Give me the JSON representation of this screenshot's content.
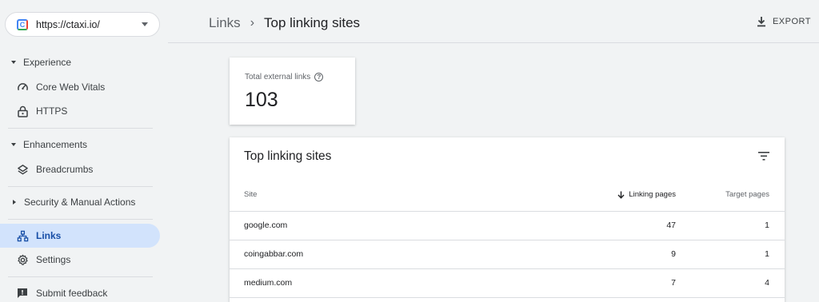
{
  "property": {
    "url": "https://ctaxi.io/"
  },
  "sidebar": {
    "sections": [
      {
        "label": "Experience"
      },
      {
        "label": "Enhancements"
      },
      {
        "label": "Security & Manual Actions"
      }
    ],
    "items": [
      {
        "label": "Core Web Vitals",
        "icon": "gauge-icon"
      },
      {
        "label": "HTTPS",
        "icon": "lock-icon"
      },
      {
        "label": "Breadcrumbs",
        "icon": "layers-icon"
      },
      {
        "label": "Links",
        "icon": "sitemap-icon",
        "active": true
      },
      {
        "label": "Settings",
        "icon": "gear-icon"
      },
      {
        "label": "Submit feedback",
        "icon": "feedback-icon"
      }
    ]
  },
  "header": {
    "breadcrumb_parent": "Links",
    "breadcrumb_current": "Top linking sites",
    "export_label": "EXPORT"
  },
  "summary": {
    "label": "Total external links",
    "value": "103"
  },
  "table": {
    "title": "Top linking sites",
    "columns": {
      "site": "Site",
      "linking": "Linking pages",
      "target": "Target pages"
    },
    "rows": [
      {
        "site": "google.com",
        "linking": "47",
        "target": "1"
      },
      {
        "site": "coingabbar.com",
        "linking": "9",
        "target": "1"
      },
      {
        "site": "medium.com",
        "linking": "7",
        "target": "4"
      }
    ]
  },
  "colors": {
    "background": "#f1f3f4",
    "active_nav": "#d2e3fc",
    "active_text": "#174ea6"
  }
}
